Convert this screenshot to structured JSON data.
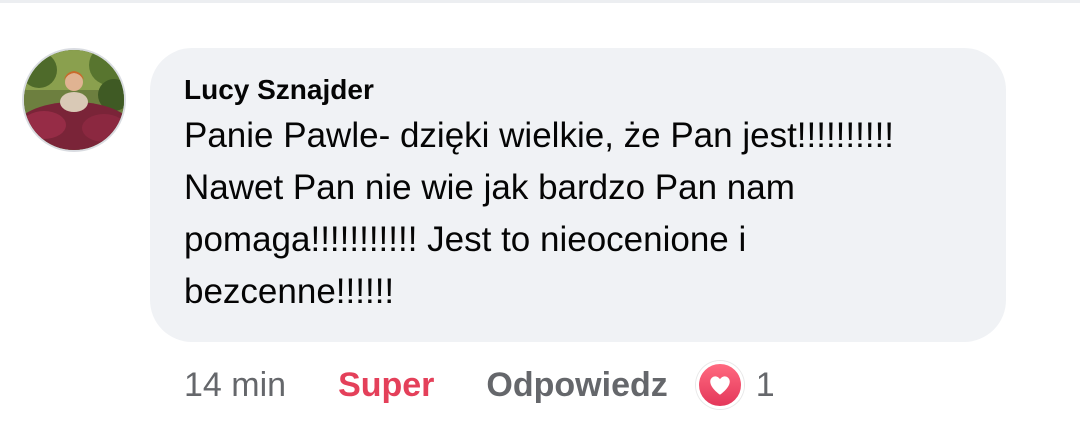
{
  "comment": {
    "author": "Lucy Sznajder",
    "text_lines": [
      "Panie Pawle- dzięki wielkie, że Pan jest!!!!!!!!!!",
      "Nawet Pan nie wie jak bardzo Pan nam",
      "pomaga!!!!!!!!!!! Jest to nieocenione i",
      "bezcenne!!!!!!"
    ],
    "timestamp": "14 min",
    "reaction_label": "Super",
    "reply_label": "Odpowiedz",
    "reaction_icon": "heart-icon",
    "reaction_count": "1"
  },
  "colors": {
    "bubble": "#f0f2f5",
    "super": "#e4405a",
    "secondary_text": "#65676b",
    "primary_text": "#050505"
  }
}
